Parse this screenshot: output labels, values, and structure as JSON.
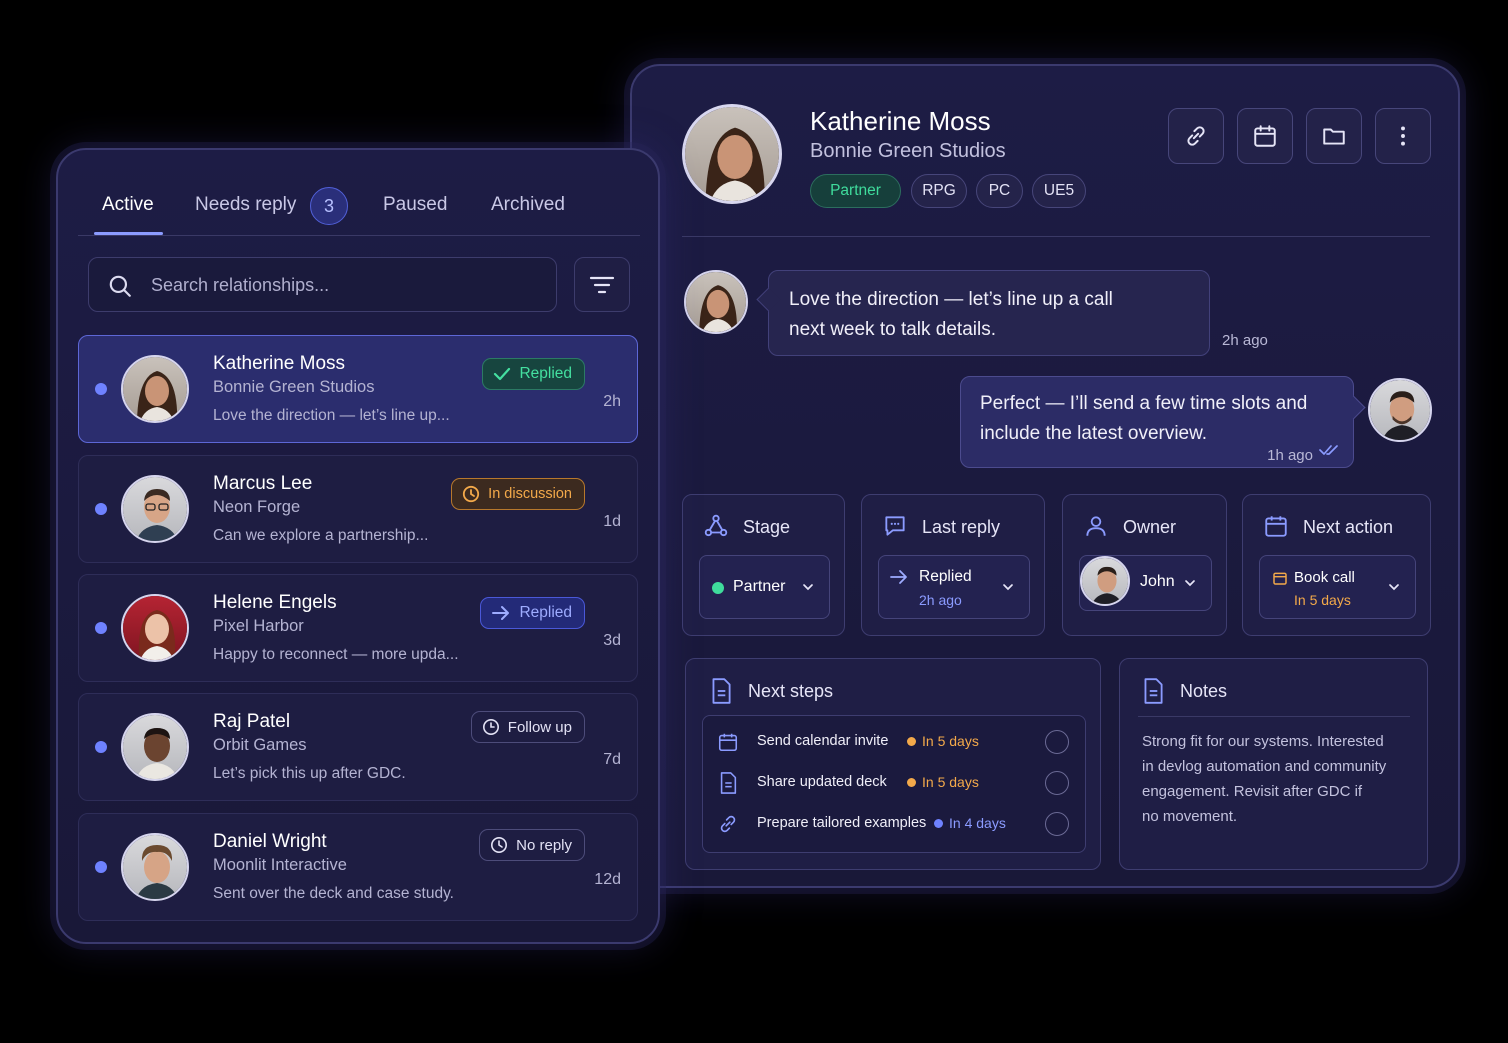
{
  "tabs": {
    "active": "Active",
    "needs_reply": "Needs reply",
    "needs_reply_count": "3",
    "paused": "Paused",
    "archived": "Archived"
  },
  "search": {
    "placeholder": "Search relationships..."
  },
  "contacts": [
    {
      "name": "Katherine Moss",
      "company": "Bonnie Green Studios",
      "preview": "Love the direction — let’s line up...",
      "time": "2h",
      "status": "Replied",
      "status_icon": "check-icon"
    },
    {
      "name": "Marcus Lee",
      "company": "Neon Forge",
      "preview": "Can we explore a partnership...",
      "time": "1d",
      "status": "In discussion",
      "status_icon": "clock-icon"
    },
    {
      "name": "Helene Engels",
      "company": "Pixel Harbor",
      "preview": "Happy to reconnect — more upda...",
      "time": "3d",
      "status": "Replied",
      "status_icon": "arrow-right-icon"
    },
    {
      "name": "Raj Patel",
      "company": "Orbit Games",
      "preview": "Let’s pick this up after GDC.",
      "time": "7d",
      "status": "Follow up",
      "status_icon": "follow-up-icon"
    },
    {
      "name": "Daniel Wright",
      "company": "Moonlit Interactive",
      "preview": "Sent over the deck and case study.",
      "time": "12d",
      "status": "No reply",
      "status_icon": "clock-icon"
    }
  ],
  "profile": {
    "name": "Katherine Moss",
    "company": "Bonnie Green Studios",
    "tags": [
      "Partner",
      "RPG",
      "PC",
      "UE5"
    ]
  },
  "messages": [
    {
      "text_line1": "Love the direction — let’s line up a call",
      "text_line2": "next week to talk details.",
      "time": "2h ago"
    },
    {
      "text_line1": "Perfect — I’ll send a few time slots and",
      "text_line2": "include the latest overview.",
      "time": "1h ago"
    }
  ],
  "info": {
    "stage": {
      "title": "Stage",
      "value": "Partner"
    },
    "last_reply": {
      "title": "Last reply",
      "value": "Replied",
      "sub": "2h ago"
    },
    "owner": {
      "title": "Owner",
      "value": "John"
    },
    "next_action": {
      "title": "Next action",
      "value": "Book call",
      "sub": "In 5 days"
    }
  },
  "next_steps": {
    "title": "Next steps",
    "items": [
      {
        "label": "Send calendar invite",
        "due": "In 5 days"
      },
      {
        "label": "Share updated deck",
        "due": "In 5 days"
      },
      {
        "label": "Prepare tailored examples",
        "due": "In 4 days"
      }
    ]
  },
  "notes": {
    "title": "Notes",
    "line1": "Strong fit for our systems. Interested",
    "line2": "in devlog automation and community",
    "line3": "engagement. Revisit after GDC if",
    "line4": "no movement."
  },
  "colors": {
    "accent": "#6f82ff",
    "green": "#3fdc9c",
    "amber": "#f3a94a",
    "blue_due": "#6f82ff"
  }
}
